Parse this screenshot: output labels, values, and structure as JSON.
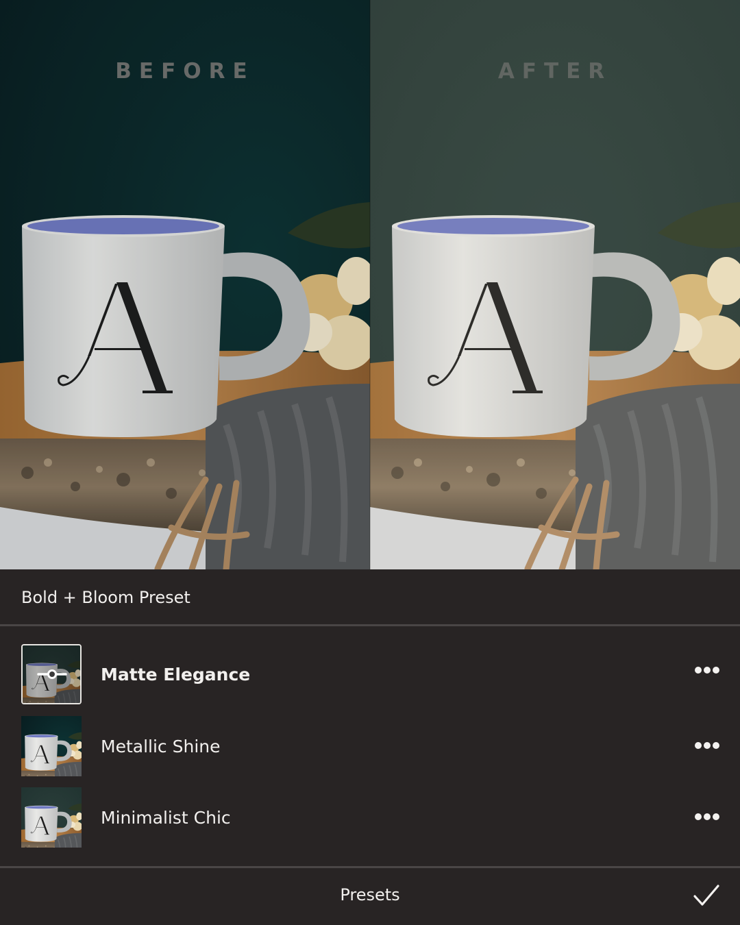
{
  "comparison": {
    "before_label": "BEFORE",
    "after_label": "AFTER"
  },
  "panel": {
    "title": "Bold + Bloom Preset",
    "presets": [
      {
        "name": "Matte Elegance",
        "selected": true
      },
      {
        "name": "Metallic Shine",
        "selected": false
      },
      {
        "name": "Minimalist Chic",
        "selected": false
      }
    ],
    "footer_label": "Presets"
  },
  "icons": {
    "more": "more-horizontal-icon",
    "confirm": "checkmark-icon",
    "adjust": "slider-adjust-icon"
  },
  "colors": {
    "panel_bg": "#282424",
    "separator": "#4a4646",
    "text": "#f2f0ee"
  }
}
